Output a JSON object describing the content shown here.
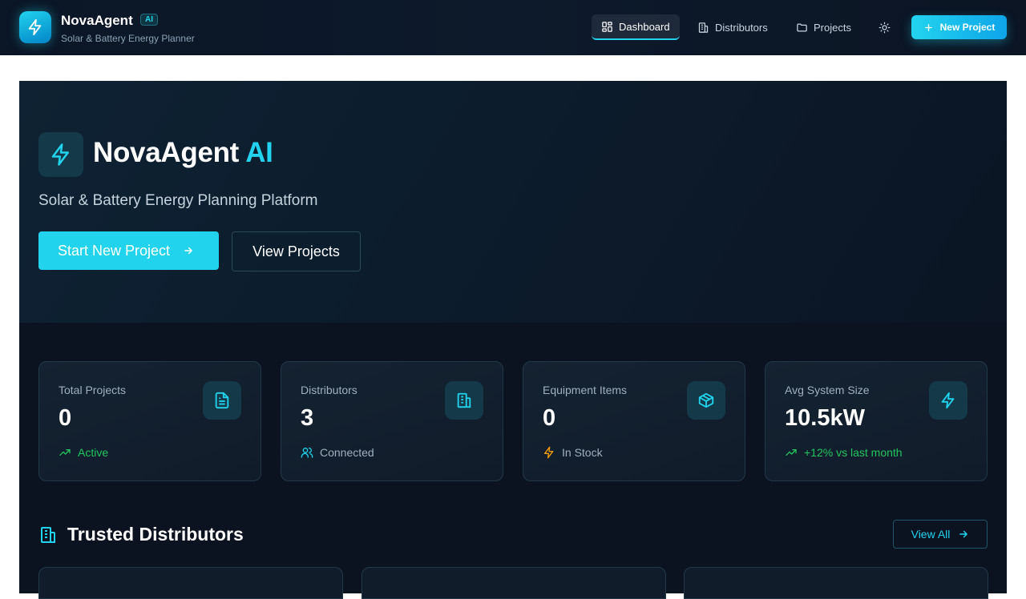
{
  "header": {
    "brand": "NovaAgent",
    "ai_badge": "AI",
    "subtitle": "Solar & Battery Energy Planner",
    "nav": [
      {
        "label": "Dashboard",
        "icon": "dashboard-icon",
        "active": true
      },
      {
        "label": "Distributors",
        "icon": "building-icon",
        "active": false
      },
      {
        "label": "Projects",
        "icon": "folder-icon",
        "active": false
      }
    ],
    "theme_icon": "sun-icon",
    "new_project_label": "New Project"
  },
  "hero": {
    "title_main": "NovaAgent",
    "title_accent": "AI",
    "subtitle": "Solar & Battery Energy Planning Platform",
    "start_label": "Start New Project",
    "view_label": "View Projects"
  },
  "stats": [
    {
      "label": "Total Projects",
      "value": "0",
      "foot": "Active",
      "icon": "document-icon",
      "foot_icon": "trending-up-icon"
    },
    {
      "label": "Distributors",
      "value": "3",
      "foot": "Connected",
      "icon": "building-icon",
      "foot_icon": "users-icon"
    },
    {
      "label": "Equipment Items",
      "value": "0",
      "foot": "In Stock",
      "icon": "box-icon",
      "foot_icon": "bolt-icon"
    },
    {
      "label": "Avg System Size",
      "value": "10.5kW",
      "foot": "+12% vs last month",
      "icon": "bolt-icon",
      "foot_icon": "trending-up-icon"
    }
  ],
  "distributors_section": {
    "title": "Trusted Distributors",
    "view_all_label": "View All"
  },
  "colors": {
    "accent": "#22d3ee",
    "positive": "#22c55e",
    "warning": "#f59e0b"
  }
}
